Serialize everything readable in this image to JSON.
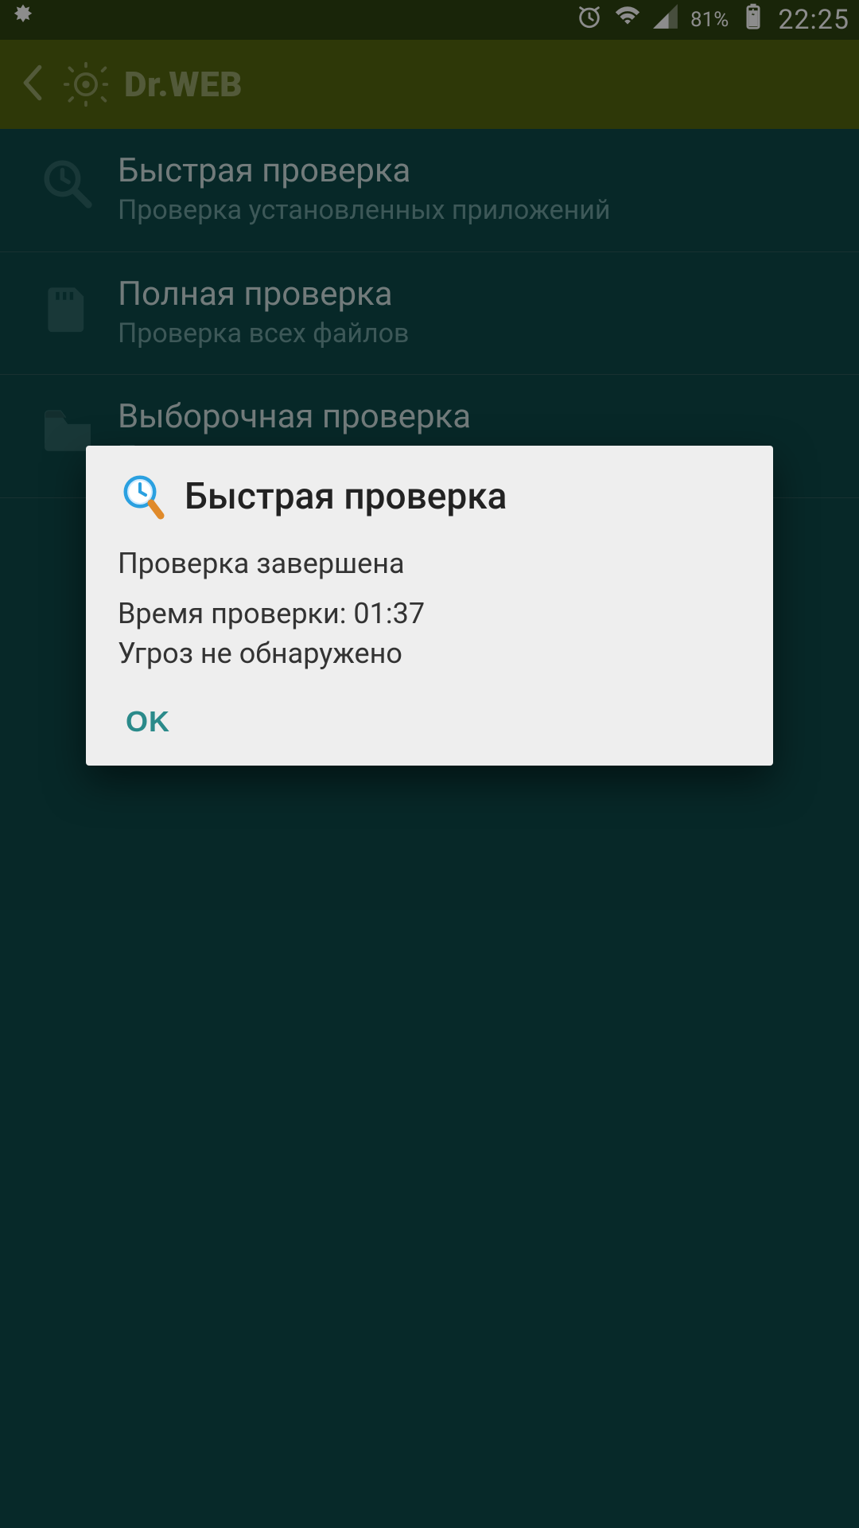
{
  "statusbar": {
    "battery_percent": "81%",
    "clock": "22:25",
    "icons": {
      "notif_app": "drweb-spider-icon",
      "alarm": "alarm-icon",
      "wifi": "wifi-icon",
      "signal": "signal-icon",
      "battery_charging": "battery-charging-icon"
    }
  },
  "actionbar": {
    "brand": "Dr.WEB"
  },
  "list": {
    "items": [
      {
        "icon": "clock-magnifier-icon",
        "title": "Быстрая проверка",
        "subtitle": "Проверка установленных приложений"
      },
      {
        "icon": "sdcard-icon",
        "title": "Полная проверка",
        "subtitle": "Проверка всех файлов"
      },
      {
        "icon": "folder-icon",
        "title": "Выборочная проверка",
        "subtitle": "Проверка элементов, указанных пользователем"
      }
    ]
  },
  "dialog": {
    "title": "Быстрая проверка",
    "line1": "Проверка завершена",
    "line2": "Время проверки: 01:37",
    "line3": "Угроз не обнаружено",
    "ok": "OK"
  }
}
